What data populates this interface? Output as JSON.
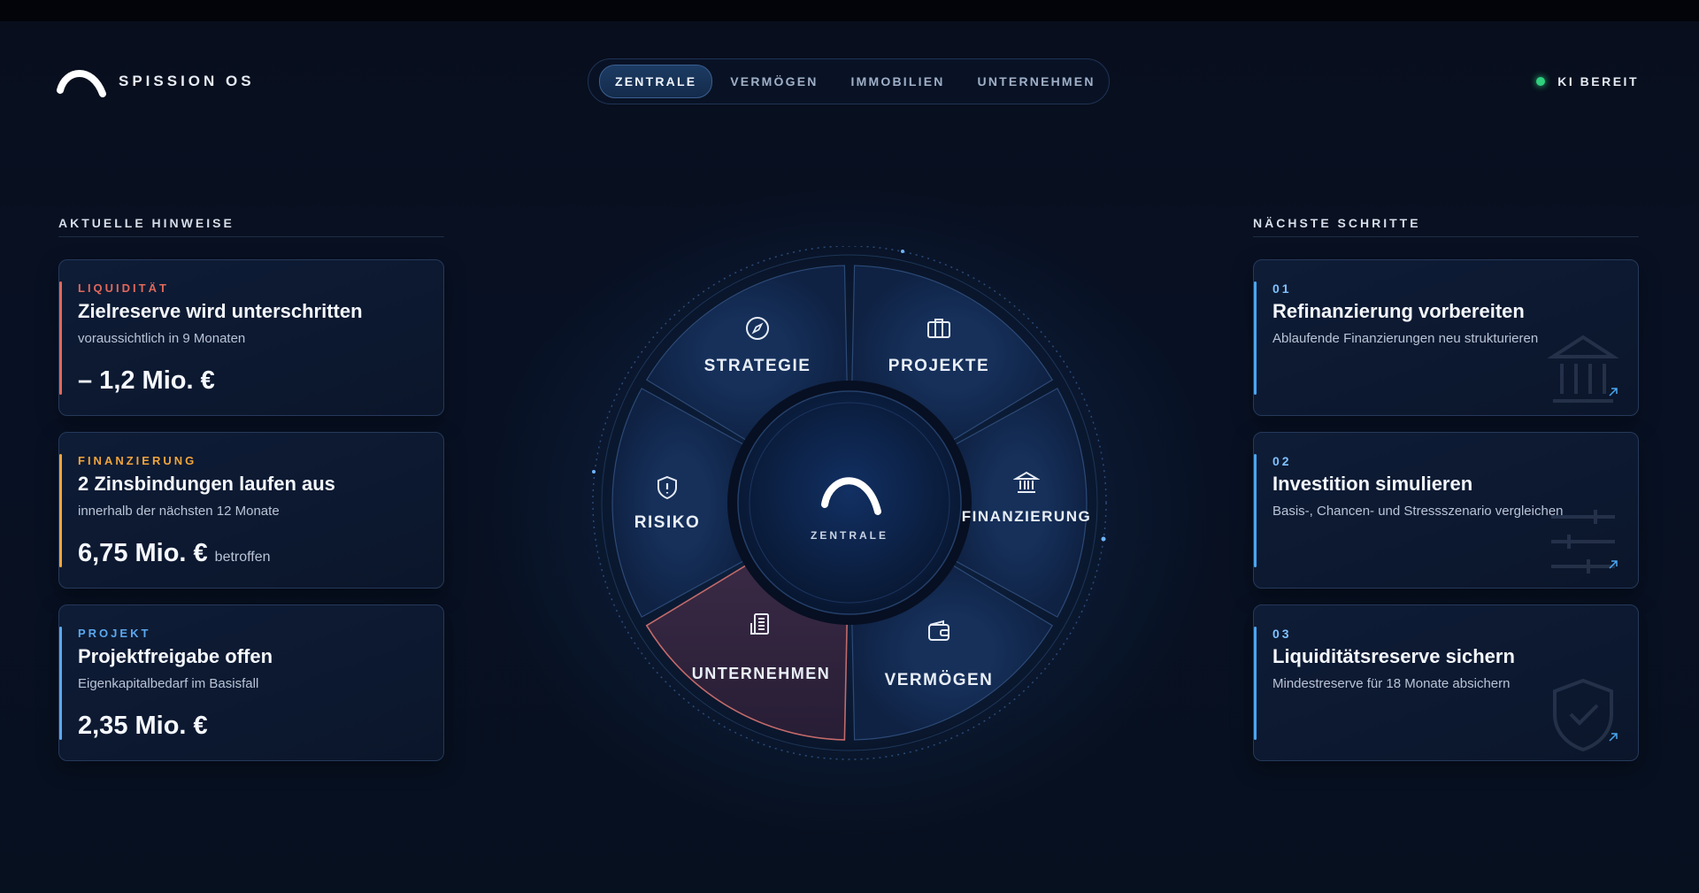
{
  "brand": {
    "name": "SPISSION OS",
    "logo_icon": "arc-logo-icon"
  },
  "nav": {
    "tabs": [
      "ZENTRALE",
      "VERMÖGEN",
      "IMMOBILIEN",
      "UNTERNEHMEN"
    ],
    "active": "ZENTRALE"
  },
  "status": {
    "label": "KI BEREIT",
    "color": "#2fd07e"
  },
  "hints": {
    "title": "AKTUELLE HINWEISE",
    "cards": [
      {
        "category": "LIQUIDITÄT",
        "title": "Zielreserve wird unterschritten",
        "subtitle": "voraussichtlich in 9 Monaten",
        "amount": "– 1,2 Mio. €",
        "note": "",
        "color": "#e0685b"
      },
      {
        "category": "FINANZIERUNG",
        "title": "2 Zinsbindungen laufen aus",
        "subtitle": "innerhalb der nächsten 12 Monate",
        "amount": "6,75 Mio. €",
        "note": "betroffen",
        "color": "#f0a53c"
      },
      {
        "category": "PROJEKT",
        "title": "Projektfreigabe offen",
        "subtitle": "Eigenkapitalbedarf im Basisfall",
        "amount": "2,35 Mio. €",
        "note": "",
        "color": "#5aa8ee"
      }
    ]
  },
  "next_steps": {
    "title": "NÄCHSTE SCHRITTE",
    "cards": [
      {
        "number": "01",
        "title": "Refinanzierung vorbereiten",
        "subtitle": "Ablaufende Finanzierungen neu strukturieren",
        "icon": "bank-icon"
      },
      {
        "number": "02",
        "title": "Investition simulieren",
        "subtitle": "Basis-, Chancen- und Stressszenario vergleichen",
        "icon": "sliders-icon"
      },
      {
        "number": "03",
        "title": "Liquiditätsreserve sichern",
        "subtitle": "Mindestreserve für 18 Monate absichern",
        "icon": "shield-check-icon"
      }
    ]
  },
  "wheel": {
    "center_label": "ZENTRALE",
    "segments": {
      "strategie": {
        "label": "STRATEGIE",
        "icon": "compass-icon"
      },
      "projekte": {
        "label": "PROJEKTE",
        "icon": "briefcase-icon"
      },
      "finanzierung": {
        "label": "FINANZIERUNG",
        "icon": "bank-icon"
      },
      "vermoegen": {
        "label": "VERMÖGEN",
        "icon": "wallet-icon"
      },
      "unternehmen": {
        "label": "UNTERNEHMEN",
        "icon": "building-icon"
      },
      "risiko": {
        "label": "RISIKO",
        "icon": "shield-alert-icon"
      }
    },
    "highlighted_segment": "unternehmen",
    "highlight_color": "#c26a6a"
  }
}
